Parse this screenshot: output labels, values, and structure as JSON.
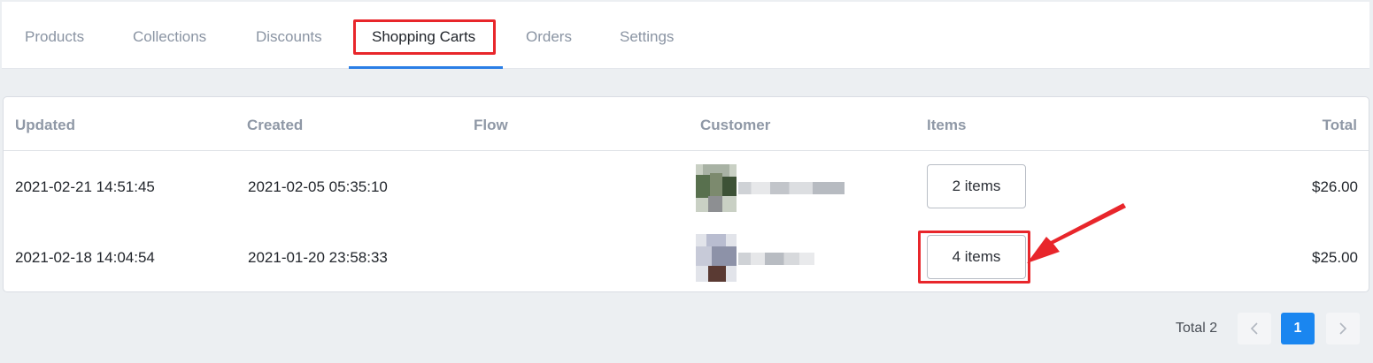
{
  "tabs": [
    {
      "label": "Products"
    },
    {
      "label": "Collections"
    },
    {
      "label": "Discounts"
    },
    {
      "label": "Shopping Carts",
      "active": true
    },
    {
      "label": "Orders"
    },
    {
      "label": "Settings"
    }
  ],
  "table": {
    "columns": [
      "Updated",
      "Created",
      "Flow",
      "Customer",
      "Items",
      "Total"
    ],
    "rows": [
      {
        "updated": "2021-02-21 14:51:45",
        "created": "2021-02-05 05:35:10",
        "flow": "",
        "customer": "",
        "items": "2 items",
        "total": "$26.00"
      },
      {
        "updated": "2021-02-18 14:04:54",
        "created": "2021-01-20 23:58:33",
        "flow": "",
        "customer": "",
        "items": "4 items",
        "total": "$25.00"
      }
    ]
  },
  "pagination": {
    "total_label": "Total 2",
    "current_page": "1",
    "prev_icon": "chevron-left-icon",
    "next_icon": "chevron-right-icon"
  },
  "colors": {
    "accent": "#1a86f0",
    "highlight": "#e8262b",
    "tab_underline": "#2a7ee6"
  }
}
